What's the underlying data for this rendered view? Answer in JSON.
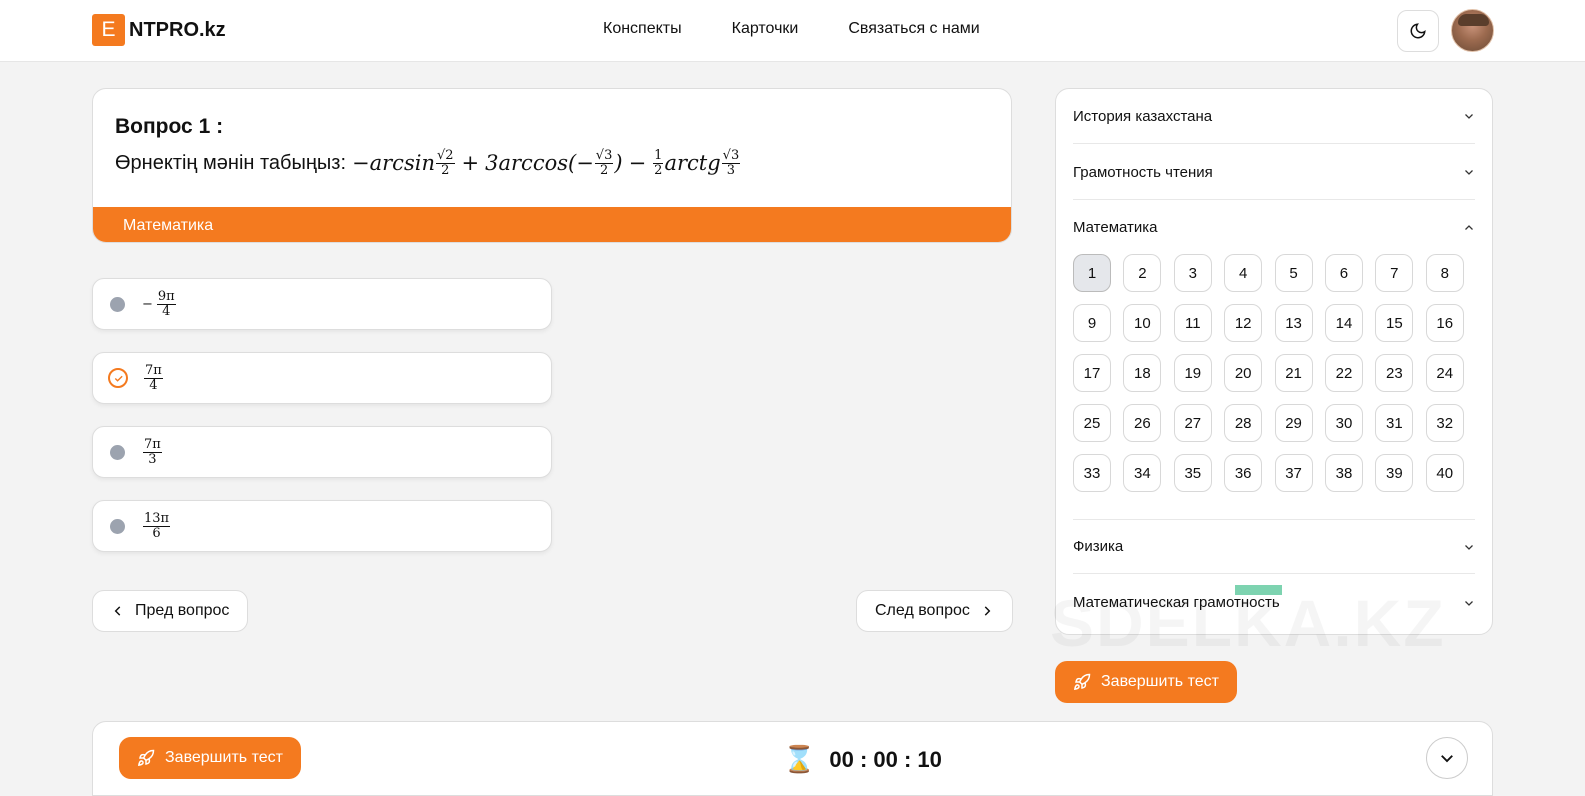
{
  "header": {
    "logo_letter": "E",
    "logo_text": "NTPRO.kz",
    "nav": [
      "Конспекты",
      "Карточки",
      "Связаться с нами"
    ]
  },
  "question": {
    "title": "Вопрос 1 :",
    "prompt": "Өрнектің мәнін табыңыз:",
    "subject": "Математика"
  },
  "answers": [
    {
      "sign": "−",
      "num": "9π",
      "den": "4",
      "selected": false
    },
    {
      "sign": "",
      "num": "7π",
      "den": "4",
      "selected": true
    },
    {
      "sign": "",
      "num": "7π",
      "den": "3",
      "selected": false
    },
    {
      "sign": "",
      "num": "13π",
      "den": "6",
      "selected": false
    }
  ],
  "navigation": {
    "prev": "Пред вопрос",
    "next": "След вопрос"
  },
  "sidebar": {
    "sections": [
      "История казахстана",
      "Грамотность чтения",
      "Математика",
      "Физика",
      "Математическая грамотность"
    ],
    "numbers": [
      "1",
      "2",
      "3",
      "4",
      "5",
      "6",
      "7",
      "8",
      "9",
      "10",
      "11",
      "12",
      "13",
      "14",
      "15",
      "16",
      "17",
      "18",
      "19",
      "20",
      "21",
      "22",
      "23",
      "24",
      "25",
      "26",
      "27",
      "28",
      "29",
      "30",
      "31",
      "32",
      "33",
      "34",
      "35",
      "36",
      "37",
      "38",
      "39",
      "40"
    ],
    "active_number": "1"
  },
  "watermark": "SDELKA.KZ",
  "finish_label": "Завершить тест",
  "timer": "00 : 00 : 10",
  "colors": {
    "accent": "#f47a1f"
  }
}
